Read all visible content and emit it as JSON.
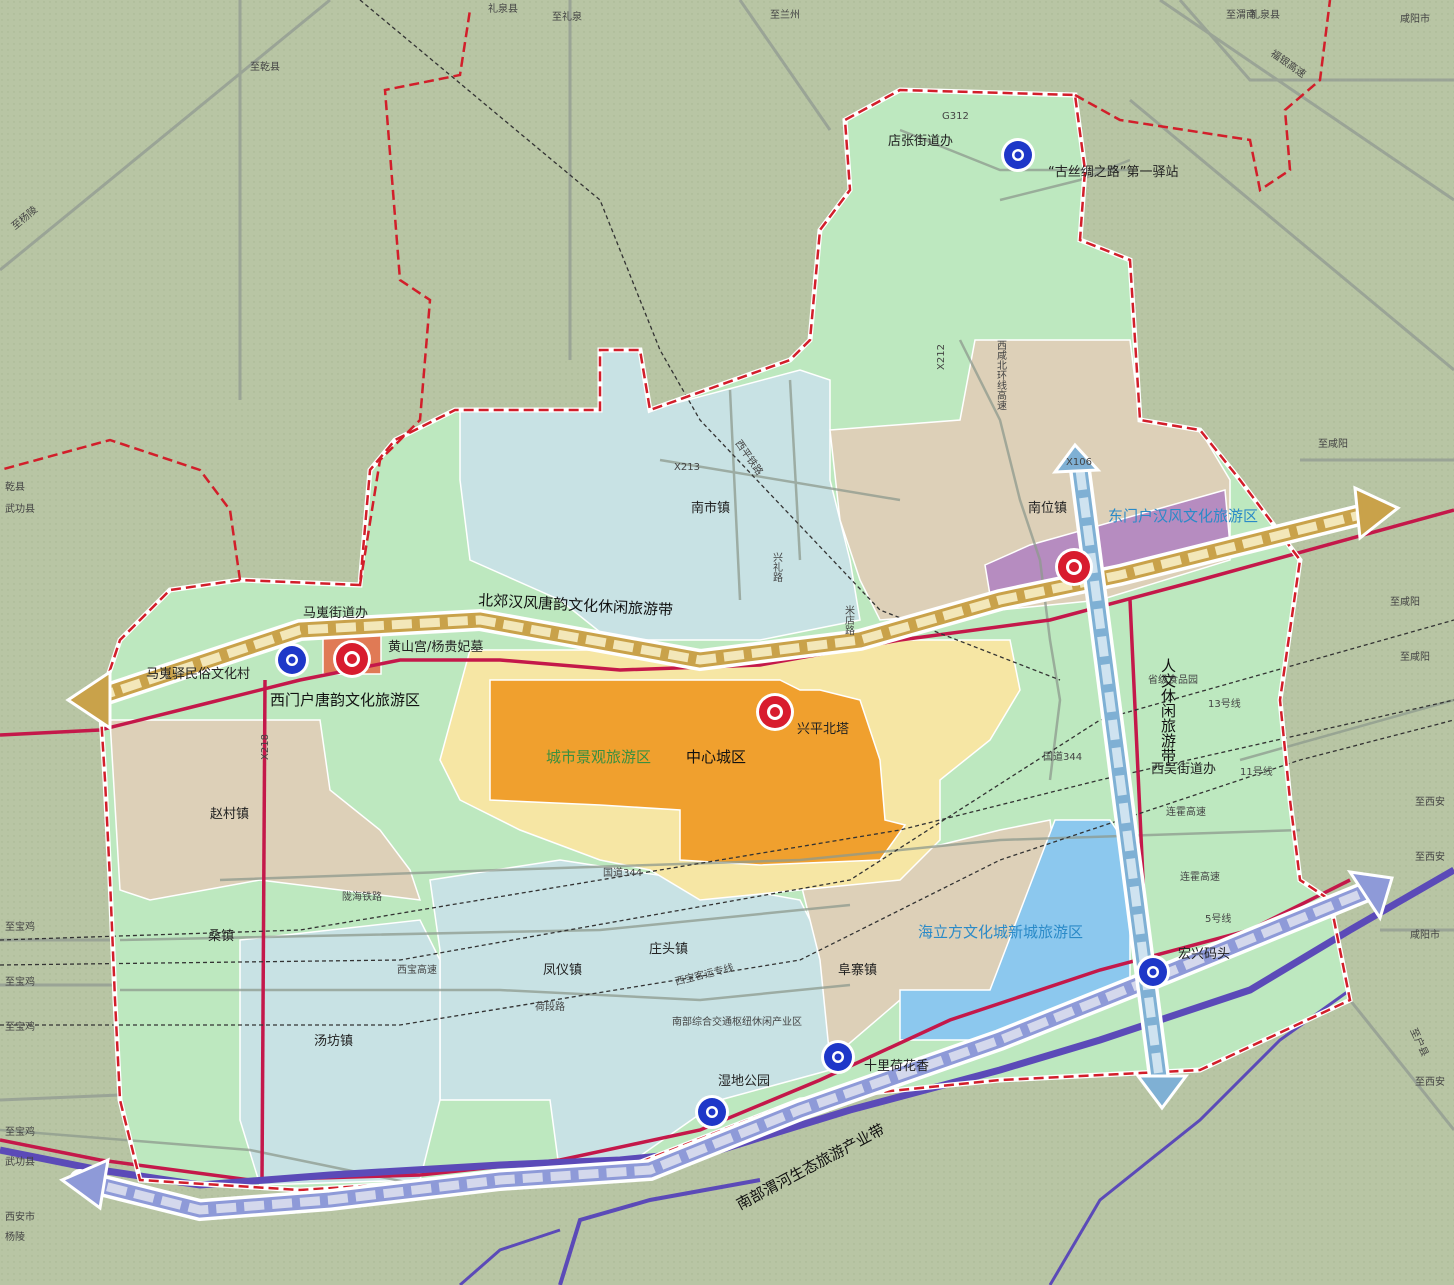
{
  "zones": {
    "center_name": "城市景观旅游区",
    "center_sub": "中心城区",
    "west": "西门户唐韵文化旅游区",
    "east": "东门户汉风文化旅游区",
    "southeast": "海立方文化城新城旅游区"
  },
  "belts": {
    "north": "北郊汉风唐韵文化休闲旅游带",
    "south": "南部渭河生态旅游产业带",
    "vertical": "人文休闲旅游带"
  },
  "towns": {
    "dianzhang": "店张街道办",
    "nanshi": "南市镇",
    "nanwei": "南位镇",
    "mawei": "马嵬街道办",
    "zhaocun": "赵村镇",
    "sangzhen": "桑镇",
    "tangfang": "汤坊镇",
    "fengyi": "凤仪镇",
    "zhuangtou": "庄头镇",
    "fuzhai": "阜寨镇",
    "xiwu": "西吴街道办"
  },
  "points": {
    "silk_road": "“古丝绸之路”第一驿站",
    "mawei_village": "马嵬驿民俗文化村",
    "huangshan": "黄山宫/杨贵妃墓",
    "xingping_tower": "兴平北塔",
    "wetland": "湿地公园",
    "lotus": "十里荷花香",
    "hongxing": "宏兴码头"
  },
  "road_labels": {
    "g312": "G312",
    "x213": "X213",
    "x212": "X212",
    "x218": "X218",
    "x106": "X106",
    "to_lanzhou": "至兰州",
    "to_weinan": "至渭南",
    "to_liquan_top": "礼泉县",
    "to_liquan": "至礼泉",
    "to_qianxian": "至乾县",
    "to_yangling": "至杨陵",
    "qianxian": "乾县",
    "wugong": "武功县",
    "to_xianyang_1": "至咸阳",
    "to_xianyang_2": "至咸阳",
    "to_xianyang_3": "至咸阳",
    "to_xian_1": "至西安",
    "to_xian_2": "至西安",
    "xianyang_city": "咸阳市",
    "to_baoji_1": "至宝鸡",
    "to_baoji_2": "至宝鸡",
    "to_baoji_3": "至宝鸡",
    "to_baoji_4": "至宝鸡",
    "xixian_ring": "西咸北环线高速",
    "longhai": "陇海铁路",
    "guodao344": "国道344",
    "xibao_gaosu": "西宝高速",
    "lianhuo": "连霍高速",
    "lianhuo2": "连霍高速",
    "xinglilu": "兴礼路",
    "xiping": "西平铁路",
    "nanbu": "南部综合交通枢纽休闲产业区",
    "shengji": "省级食品园",
    "line5": "5号线",
    "line13": "13号线",
    "line11": "11号线",
    "xibao_kexian": "西宝客运专线",
    "heduanlu": "荷段路",
    "mihelu": "米店路",
    "guodao_344b": "国道344",
    "wugong_b": "武功县",
    "xian_city": "西安市",
    "yangling_b": "杨陵",
    "to_huxian": "至户县",
    "to_xian_3": "至西安",
    "fuma": "福银高速",
    "xianyang_top": "咸阳市",
    "liquan_top2": "礼泉县"
  },
  "colors": {
    "green": "#bde8bf",
    "blue": "#c8e2e4",
    "tan": "#ddd0b8",
    "orange": "#f0a02e",
    "yellow": "#f6e6a4",
    "purple": "#b68cc0",
    "lightblue": "#8cc8ee",
    "boundary": "#d21e2a"
  }
}
